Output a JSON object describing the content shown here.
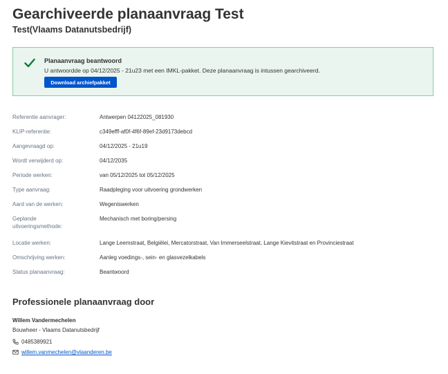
{
  "header": {
    "title": "Gearchiveerde planaanvraag Test",
    "subtitle": "Test(Vlaams Datanutsbedrijf)"
  },
  "alert": {
    "icon": "check-icon",
    "title": "Planaanvraag beantwoord",
    "text": "U antwoordde op 04/12/2025 - 21u23 met een IMKL-pakket. Deze planaanvraag is intussen gearchiveerd.",
    "button_label": "Download archiefpakket",
    "colors": {
      "background": "#e9f5ee",
      "border": "#8bc9a5",
      "check": "#0e7a3e",
      "button": "#0055cc"
    }
  },
  "details": [
    {
      "label": "Referentie aanvrager:",
      "value": "Antwerpen 04122025_081930"
    },
    {
      "label": "KLIP-referentie:",
      "value": "c349efff-af0f-4f6f-89ef-23d9173debcd"
    },
    {
      "label": "Aangevraagd op:",
      "value": "04/12/2025 - 21u19"
    },
    {
      "label": "Wordt verwijderd op:",
      "value": "04/12/2035"
    },
    {
      "label": "Periode werken:",
      "value": "van 05/12/2025 tot 05/12/2025"
    },
    {
      "label": "Type aanvraag:",
      "value": "Raadpleging voor uitvoering grondwerken"
    },
    {
      "label": "Aard van de werken:",
      "value": "Wegeniswerken"
    },
    {
      "label": "Geplande uitvoeringsmethode:",
      "value": "Mechanisch met boring/persing"
    },
    {
      "label": "Locatie werken:",
      "value": "Lange Leemstraat, Belgiëlei, Mercatorstraat, Van Immerseelstraat, Lange Kievitstraat en Provinciestraat"
    },
    {
      "label": "Omschrijving werken:",
      "value": "Aanleg voedings-, sein- en glasvezelkabels"
    },
    {
      "label": "Status planaanvraag:",
      "value": "Beantwoord"
    }
  ],
  "professional": {
    "section_title": "Professionele planaanvraag door",
    "name": "Willem Vandermechelen",
    "role": "Bouwheer - Vlaams Datanutsbedrijf",
    "phone": "0485389921",
    "email": "willem.vanmechelen@vlaanderen.be",
    "phone_icon": "phone-icon",
    "email_icon": "mail-icon"
  }
}
